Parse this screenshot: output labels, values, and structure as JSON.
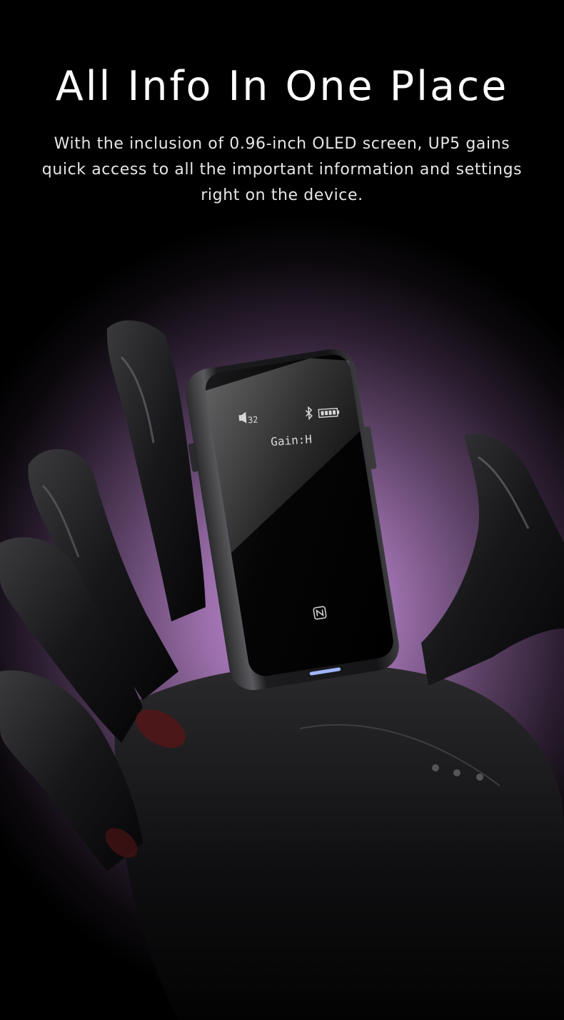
{
  "headline": "All Info In One Place",
  "description": "With the inclusion of 0.96-inch OLED screen, UP5 gains quick access to all the important information and settings right on the device.",
  "device": {
    "screen": {
      "volume": "32",
      "status_text": "Gain:H",
      "icons": [
        "speaker-icon",
        "bluetooth-icon",
        "battery-icon"
      ]
    },
    "nfc_icon": "nfc-icon"
  },
  "colors": {
    "background": "#000000",
    "glow": "#c996da",
    "text": "#ffffff"
  }
}
